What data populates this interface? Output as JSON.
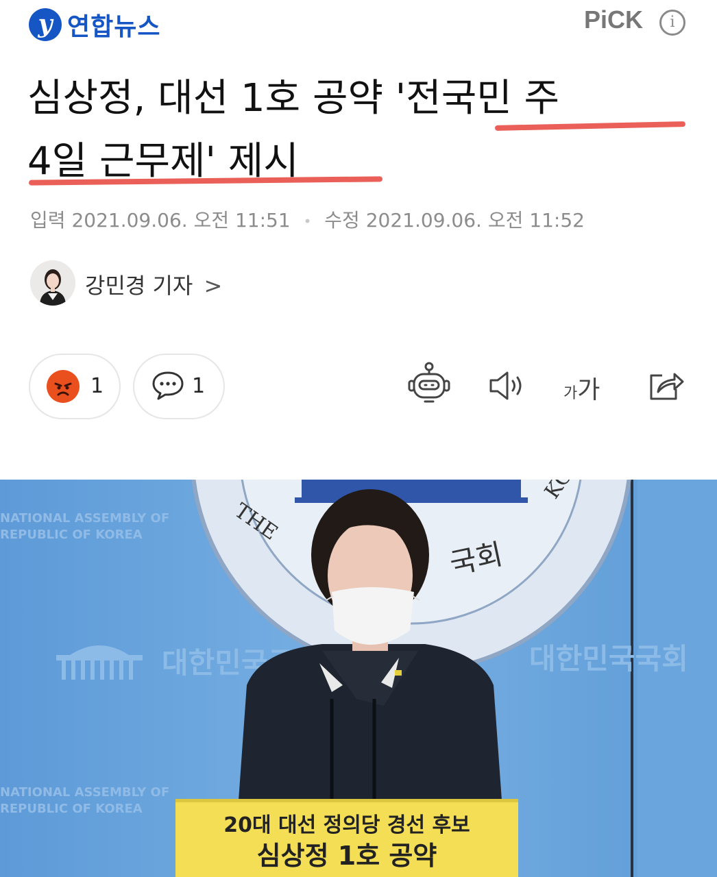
{
  "header": {
    "logo_mark": "y",
    "logo_text": "연합뉴스",
    "pick_label": "PiCK",
    "info_glyph": "i"
  },
  "article": {
    "headline_line1": "심상정, 대선 1호 공약 '전국민 주",
    "headline_line2": "4일 근무제' 제시",
    "input_label": "입력",
    "input_date": "2021.09.06. 오전 11:51",
    "separator": "•",
    "edit_label": "수정",
    "edit_date": "2021.09.06. 오전 11:52",
    "author": "강민경 기자",
    "author_chevron": ">"
  },
  "reactions": {
    "angry_count": "1",
    "comment_count": "1"
  },
  "toolbar": {
    "font_size_small": "가",
    "font_size_large": "가",
    "icons": [
      "robot-summary-icon",
      "speaker-icon",
      "font-size-icon",
      "share-icon"
    ]
  },
  "photo": {
    "backdrop_top_left_1": "NATIONAL ASSEMBLY OF",
    "backdrop_top_left_2": "REPUBLIC OF KOREA",
    "seal_text_the": "THE",
    "seal_text_korea": "KOREA",
    "seal_text_korean": "국회",
    "backdrop_korean_left": "대한민국국",
    "backdrop_korean_right": "대한민국국회",
    "backdrop_bottom_left_1": "NATIONAL ASSEMBLY OF",
    "backdrop_bottom_left_2": "REPUBLIC OF KOREA",
    "podium_line1": "20대 대선 정의당 경선 후보",
    "podium_line2": "심상정 1호 공약"
  },
  "colors": {
    "brand": "#1656c4",
    "underline": "#e8534b",
    "angry": "#ea4f1e",
    "podium": "#f3de55"
  }
}
